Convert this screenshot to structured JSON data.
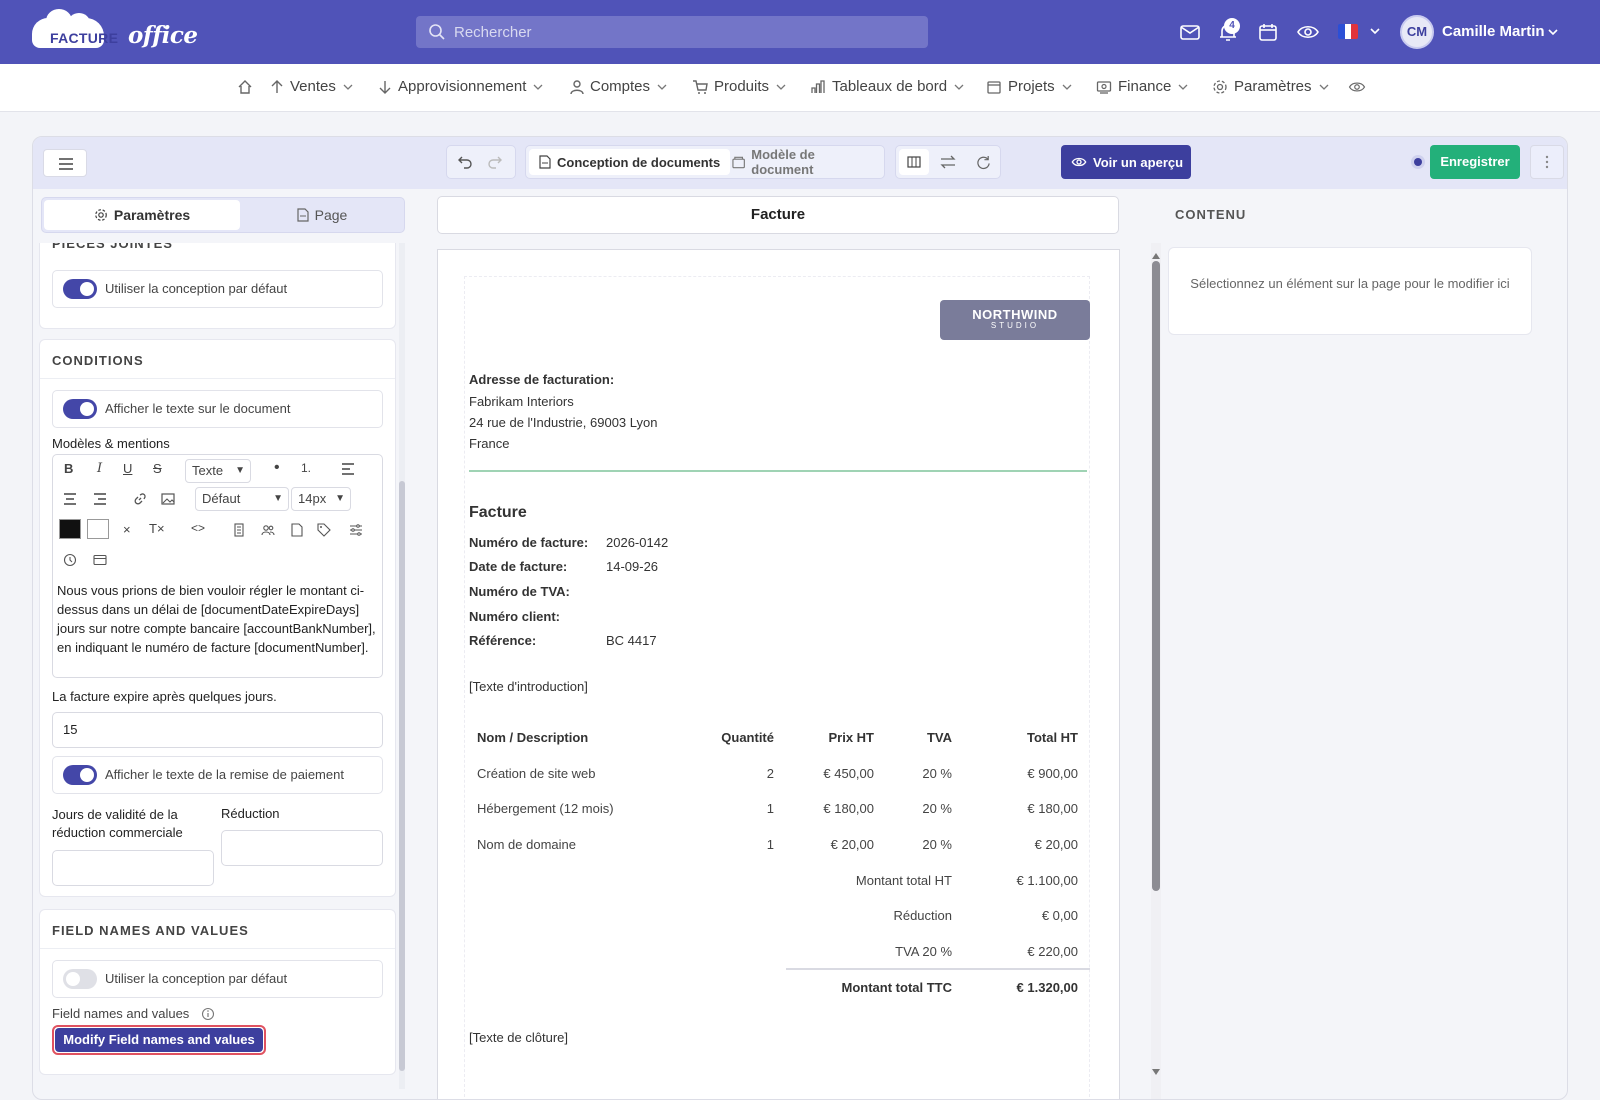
{
  "brand": {
    "name_part1": "FACTURE",
    "name_part2": "office"
  },
  "search": {
    "placeholder": "Rechercher"
  },
  "header": {
    "notifications_count": "4",
    "user_initials": "CM",
    "user_name": "Camille Martin"
  },
  "nav": {
    "items": [
      {
        "label": "Ventes",
        "icon": "arrow-up-icon"
      },
      {
        "label": "Approvisionnement",
        "icon": "arrow-down-icon"
      },
      {
        "label": "Comptes",
        "icon": "user-icon"
      },
      {
        "label": "Produits",
        "icon": "cart-icon"
      },
      {
        "label": "Tableaux de bord",
        "icon": "bar-chart-icon"
      },
      {
        "label": "Projets",
        "icon": "calendar-icon"
      },
      {
        "label": "Finance",
        "icon": "finance-icon"
      },
      {
        "label": "Paramètres",
        "icon": "gear-icon"
      }
    ]
  },
  "editor": {
    "tab_design": "Conception de documents",
    "tab_template": "Modèle de document",
    "preview_label": "Voir un aperçu",
    "save_label": "Enregistrer"
  },
  "left_panel": {
    "tab_settings": "Paramètres",
    "tab_page": "Page",
    "attachments": {
      "title": "PIÈCES JOINTES",
      "toggle_label": "Utiliser la conception par défaut",
      "toggle_on": true
    },
    "conditions": {
      "title": "CONDITIONS",
      "show_text_label": "Afficher le texte sur le document",
      "templates_label": "Modèles & mentions",
      "rte": {
        "text_style": "Texte",
        "font": "Défaut",
        "size": "14px"
      },
      "text": "Nous vous prions de bien vouloir régler le montant ci-dessus dans un délai de [documentDateExpireDays] jours sur notre compte bancaire [accountBankNumber], en indiquant le numéro de facture [documentNumber].",
      "expires_label": "La facture expire après quelques jours.",
      "expires_value": "15",
      "show_discount_label": "Afficher le texte de la remise de paiement",
      "validity_label": "Jours de validité de la réduction commerciale",
      "reduction_label": "Réduction",
      "validity_value": "",
      "reduction_value": ""
    },
    "field_names": {
      "title": "FIELD NAMES AND VALUES",
      "toggle_label": "Utiliser la conception par défaut",
      "toggle_on": false,
      "label": "Field names and values",
      "button": "Modify Field names and values"
    }
  },
  "document": {
    "title": "Facture",
    "logo_main": "NORTHWIND",
    "logo_sub": "STUDIO",
    "billing_label": "Adresse de facturation:",
    "billing_name": "Fabrikam Interiors",
    "billing_street": "24 rue de l'Industrie, 69003 Lyon",
    "billing_country": "France",
    "heading": "Facture",
    "fields": [
      {
        "label": "Numéro de facture:",
        "value": "2026-0142"
      },
      {
        "label": "Date de facture:",
        "value": "14-09-26"
      },
      {
        "label": "Numéro de TVA:",
        "value": ""
      },
      {
        "label": "Numéro client:",
        "value": ""
      },
      {
        "label": "Référence:",
        "value": "BC 4417"
      }
    ],
    "intro": "[Texte d'introduction]",
    "columns": [
      "Nom / Description",
      "Quantité",
      "Prix HT",
      "TVA",
      "Total HT"
    ],
    "rows": [
      [
        "Création de site web",
        "2",
        "€ 450,00",
        "20 %",
        "€ 900,00"
      ],
      [
        "Hébergement (12 mois)",
        "1",
        "€ 180,00",
        "20 %",
        "€ 180,00"
      ],
      [
        "Nom de domaine",
        "1",
        "€ 20,00",
        "20 %",
        "€ 20,00"
      ]
    ],
    "totals": [
      {
        "label": "Montant total HT",
        "value": "€ 1.100,00"
      },
      {
        "label": "Réduction",
        "value": "€ 0,00"
      },
      {
        "label": "TVA 20 %",
        "value": "€ 220,00"
      }
    ],
    "grand_total_label": "Montant total TTC",
    "grand_total_value": "€ 1.320,00",
    "closing": "[Texte de clôture]"
  },
  "right_panel": {
    "title": "CONTENU",
    "hint": "Sélectionnez un élément sur la page pour le modifier ici"
  }
}
